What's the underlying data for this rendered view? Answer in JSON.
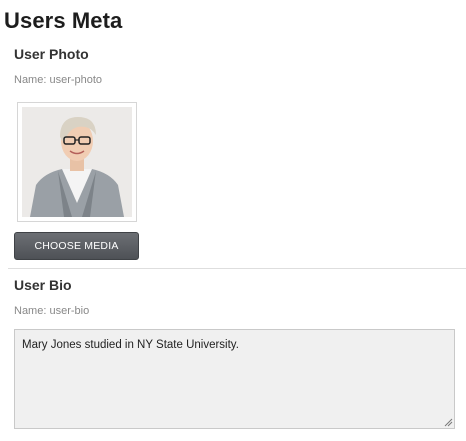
{
  "page": {
    "title": "Users Meta"
  },
  "photo_section": {
    "label": "User Photo",
    "field_name": "Name: user-photo",
    "choose_label": "CHOOSE MEDIA"
  },
  "bio_section": {
    "label": "User Bio",
    "field_name": "Name: user-bio",
    "value": "Mary Jones studied in NY State University."
  },
  "icons": [
    "photo-thumbnail",
    "resize-grip-icon"
  ]
}
